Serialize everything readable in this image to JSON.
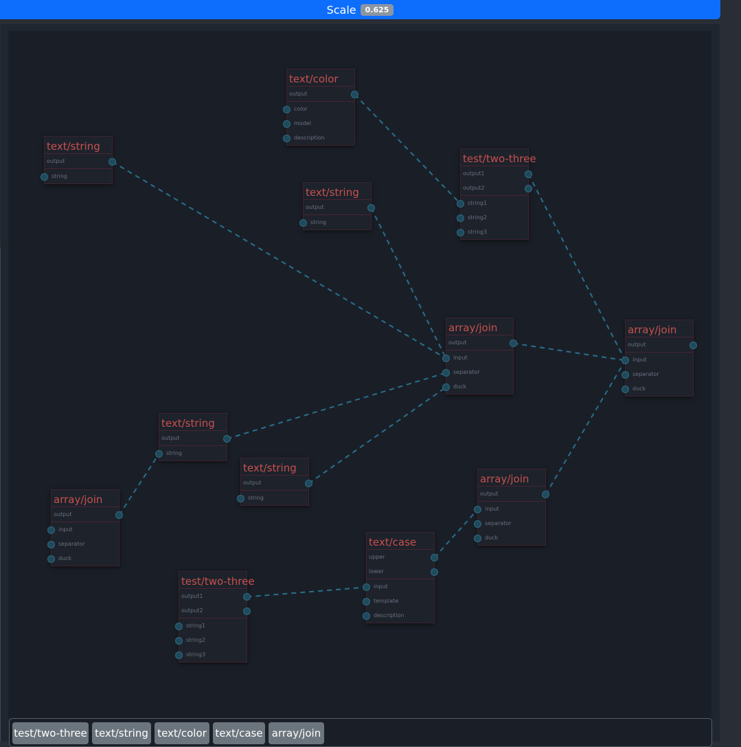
{
  "header": {
    "label": "Scale",
    "value": "0.625"
  },
  "nodes": [
    {
      "id": "color1",
      "title": "text/color",
      "outputs": [
        "output"
      ],
      "inputs": [
        "color",
        "model",
        "description"
      ]
    },
    {
      "id": "str1",
      "title": "text/string",
      "outputs": [
        "output"
      ],
      "inputs": [
        "string"
      ]
    },
    {
      "id": "str2",
      "title": "text/string",
      "outputs": [
        "output"
      ],
      "inputs": [
        "string"
      ]
    },
    {
      "id": "twothree1",
      "title": "test/two-three",
      "outputs": [
        "output1",
        "output2"
      ],
      "inputs": [
        "string1",
        "string2",
        "string3"
      ]
    },
    {
      "id": "join1",
      "title": "array/join",
      "outputs": [
        "output"
      ],
      "inputs": [
        "input",
        "separator",
        "duck"
      ]
    },
    {
      "id": "join2",
      "title": "array/join",
      "outputs": [
        "output"
      ],
      "inputs": [
        "input",
        "separator",
        "duck"
      ]
    },
    {
      "id": "str3",
      "title": "text/string",
      "outputs": [
        "output"
      ],
      "inputs": [
        "string"
      ]
    },
    {
      "id": "str4",
      "title": "text/string",
      "outputs": [
        "output"
      ],
      "inputs": [
        "string"
      ]
    },
    {
      "id": "join3",
      "title": "array/join",
      "outputs": [
        "output"
      ],
      "inputs": [
        "input",
        "separator",
        "duck"
      ]
    },
    {
      "id": "join4",
      "title": "array/join",
      "outputs": [
        "output"
      ],
      "inputs": [
        "input",
        "separator",
        "duck"
      ]
    },
    {
      "id": "case1",
      "title": "text/case",
      "outputs": [
        "upper",
        "lower"
      ],
      "inputs": [
        "input",
        "template",
        "description"
      ]
    },
    {
      "id": "twothree2",
      "title": "test/two-three",
      "outputs": [
        "output1",
        "output2"
      ],
      "inputs": [
        "string1",
        "string2",
        "string3"
      ]
    }
  ],
  "links": [
    {
      "from": "color1.output",
      "to": "twothree1.string1"
    },
    {
      "from": "str1.output",
      "to": "join1.input"
    },
    {
      "from": "str2.output",
      "to": "join1.input"
    },
    {
      "from": "twothree1.output1",
      "to": "join2.input"
    },
    {
      "from": "join1.output",
      "to": "join2.input"
    },
    {
      "from": "str3.output",
      "to": "join1.separator"
    },
    {
      "from": "str4.output",
      "to": "join1.duck"
    },
    {
      "from": "join3.output",
      "to": "str3.string"
    },
    {
      "from": "join4.output",
      "to": "join2.input"
    },
    {
      "from": "case1.upper",
      "to": "join4.input"
    },
    {
      "from": "twothree2.output1",
      "to": "case1.input"
    }
  ],
  "palette": [
    "test/two-three",
    "text/string",
    "text/color",
    "text/case",
    "array/join"
  ],
  "colors": {
    "accent": "#0d6efd",
    "node_title": "#c9514f",
    "wire": "#2a6f8f",
    "canvas": "#1a1f27"
  }
}
